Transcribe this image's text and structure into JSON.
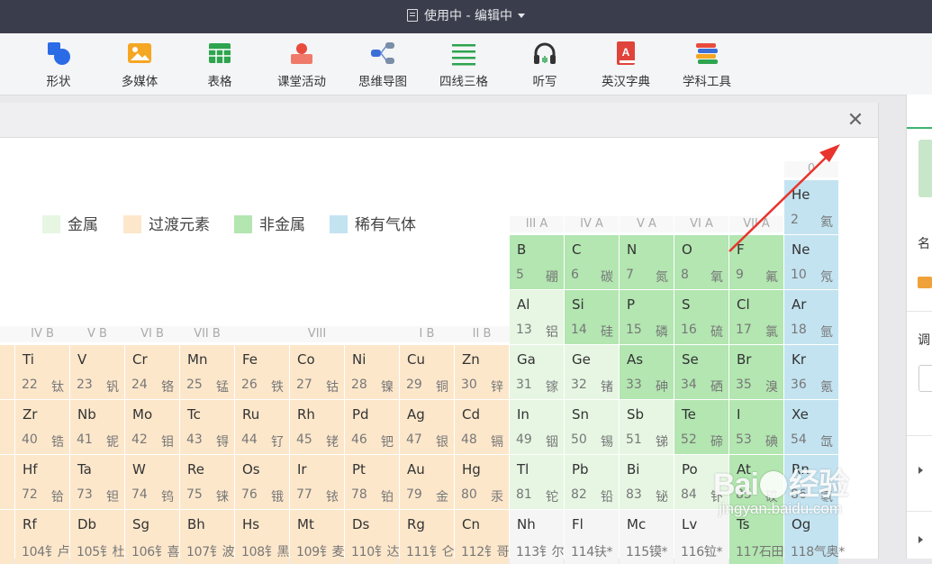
{
  "window": {
    "title": "使用中 - 编辑中"
  },
  "toolbar": [
    {
      "label": "形状",
      "icon": "shapes-icon"
    },
    {
      "label": "多媒体",
      "icon": "image-icon"
    },
    {
      "label": "表格",
      "icon": "table-icon"
    },
    {
      "label": "课堂活动",
      "icon": "classroom-activity-icon"
    },
    {
      "label": "思维导图",
      "icon": "mind-map-icon"
    },
    {
      "label": "四线三格",
      "icon": "four-line-grid-icon"
    },
    {
      "label": "听写",
      "icon": "headphones-icon"
    },
    {
      "label": "英汉字典",
      "icon": "dictionary-icon"
    },
    {
      "label": "学科工具",
      "icon": "books-icon"
    }
  ],
  "right_panel": {
    "name_label": "名",
    "adjust_label": "调"
  },
  "dialog": {
    "close_icon": "✕"
  },
  "legend": [
    {
      "label": "金属",
      "color": "#e6f6e3"
    },
    {
      "label": "过渡元素",
      "color": "#fde7cb"
    },
    {
      "label": "非金属",
      "color": "#b3e6b1"
    },
    {
      "label": "稀有气体",
      "color": "#c3e3f1"
    }
  ],
  "colors": {
    "metal": "#e6f6e3",
    "transition": "#fde7cb",
    "nonmetal": "#b3e6b1",
    "noble": "#c3e3f1",
    "other": "#f5f5f5"
  },
  "groups": [
    "IV B",
    "V B",
    "VI B",
    "VII B",
    "VIII",
    "I B",
    "II B",
    "III A",
    "IV A",
    "V A",
    "VI A",
    "VII A",
    "0"
  ],
  "elements": [
    {
      "s": "He",
      "n": "2",
      "c": "氦",
      "t": "noble"
    },
    {
      "s": "B",
      "n": "5",
      "c": "硼",
      "t": "nonmetal"
    },
    {
      "s": "C",
      "n": "6",
      "c": "碳",
      "t": "nonmetal"
    },
    {
      "s": "N",
      "n": "7",
      "c": "氮",
      "t": "nonmetal"
    },
    {
      "s": "O",
      "n": "8",
      "c": "氧",
      "t": "nonmetal"
    },
    {
      "s": "F",
      "n": "9",
      "c": "氟",
      "t": "nonmetal"
    },
    {
      "s": "Ne",
      "n": "10",
      "c": "氖",
      "t": "noble"
    },
    {
      "s": "Al",
      "n": "13",
      "c": "铝",
      "t": "metal"
    },
    {
      "s": "Si",
      "n": "14",
      "c": "硅",
      "t": "nonmetal"
    },
    {
      "s": "P",
      "n": "15",
      "c": "磷",
      "t": "nonmetal"
    },
    {
      "s": "S",
      "n": "16",
      "c": "硫",
      "t": "nonmetal"
    },
    {
      "s": "Cl",
      "n": "17",
      "c": "氯",
      "t": "nonmetal"
    },
    {
      "s": "Ar",
      "n": "18",
      "c": "氩",
      "t": "noble"
    },
    {
      "s": "Ti",
      "n": "22",
      "c": "钛",
      "t": "transition"
    },
    {
      "s": "V",
      "n": "23",
      "c": "钒",
      "t": "transition"
    },
    {
      "s": "Cr",
      "n": "24",
      "c": "铬",
      "t": "transition"
    },
    {
      "s": "Mn",
      "n": "25",
      "c": "锰",
      "t": "transition"
    },
    {
      "s": "Fe",
      "n": "26",
      "c": "铁",
      "t": "transition"
    },
    {
      "s": "Co",
      "n": "27",
      "c": "钴",
      "t": "transition"
    },
    {
      "s": "Ni",
      "n": "28",
      "c": "镍",
      "t": "transition"
    },
    {
      "s": "Cu",
      "n": "29",
      "c": "铜",
      "t": "transition"
    },
    {
      "s": "Zn",
      "n": "30",
      "c": "锌",
      "t": "transition"
    },
    {
      "s": "Ga",
      "n": "31",
      "c": "镓",
      "t": "metal"
    },
    {
      "s": "Ge",
      "n": "32",
      "c": "锗",
      "t": "metal"
    },
    {
      "s": "As",
      "n": "33",
      "c": "砷",
      "t": "nonmetal"
    },
    {
      "s": "Se",
      "n": "34",
      "c": "硒",
      "t": "nonmetal"
    },
    {
      "s": "Br",
      "n": "35",
      "c": "溴",
      "t": "nonmetal"
    },
    {
      "s": "Kr",
      "n": "36",
      "c": "氪",
      "t": "noble"
    },
    {
      "s": "Zr",
      "n": "40",
      "c": "锆",
      "t": "transition"
    },
    {
      "s": "Nb",
      "n": "41",
      "c": "铌",
      "t": "transition"
    },
    {
      "s": "Mo",
      "n": "42",
      "c": "钼",
      "t": "transition"
    },
    {
      "s": "Tc",
      "n": "43",
      "c": "锝",
      "t": "transition"
    },
    {
      "s": "Ru",
      "n": "44",
      "c": "钌",
      "t": "transition"
    },
    {
      "s": "Rh",
      "n": "45",
      "c": "铑",
      "t": "transition"
    },
    {
      "s": "Pd",
      "n": "46",
      "c": "钯",
      "t": "transition"
    },
    {
      "s": "Ag",
      "n": "47",
      "c": "银",
      "t": "transition"
    },
    {
      "s": "Cd",
      "n": "48",
      "c": "镉",
      "t": "transition"
    },
    {
      "s": "In",
      "n": "49",
      "c": "铟",
      "t": "metal"
    },
    {
      "s": "Sn",
      "n": "50",
      "c": "锡",
      "t": "metal"
    },
    {
      "s": "Sb",
      "n": "51",
      "c": "锑",
      "t": "metal"
    },
    {
      "s": "Te",
      "n": "52",
      "c": "碲",
      "t": "nonmetal"
    },
    {
      "s": "I",
      "n": "53",
      "c": "碘",
      "t": "nonmetal"
    },
    {
      "s": "Xe",
      "n": "54",
      "c": "氙",
      "t": "noble"
    },
    {
      "s": "Hf",
      "n": "72",
      "c": "铪",
      "t": "transition"
    },
    {
      "s": "Ta",
      "n": "73",
      "c": "钽",
      "t": "transition"
    },
    {
      "s": "W",
      "n": "74",
      "c": "钨",
      "t": "transition"
    },
    {
      "s": "Re",
      "n": "75",
      "c": "铼",
      "t": "transition"
    },
    {
      "s": "Os",
      "n": "76",
      "c": "锇",
      "t": "transition"
    },
    {
      "s": "Ir",
      "n": "77",
      "c": "铱",
      "t": "transition"
    },
    {
      "s": "Pt",
      "n": "78",
      "c": "铂",
      "t": "transition"
    },
    {
      "s": "Au",
      "n": "79",
      "c": "金",
      "t": "transition"
    },
    {
      "s": "Hg",
      "n": "80",
      "c": "汞",
      "t": "transition"
    },
    {
      "s": "Tl",
      "n": "81",
      "c": "铊",
      "t": "metal"
    },
    {
      "s": "Pb",
      "n": "82",
      "c": "铅",
      "t": "metal"
    },
    {
      "s": "Bi",
      "n": "83",
      "c": "铋",
      "t": "metal"
    },
    {
      "s": "Po",
      "n": "84",
      "c": "钋",
      "t": "metal"
    },
    {
      "s": "At",
      "n": "85",
      "c": "砹",
      "t": "nonmetal"
    },
    {
      "s": "Rn",
      "n": "86",
      "c": "氡",
      "t": "noble"
    },
    {
      "s": "Rf",
      "n": "104",
      "c": "钅卢*",
      "t": "transition",
      "comb": true
    },
    {
      "s": "Db",
      "n": "105",
      "c": "钅杜*",
      "t": "transition",
      "comb": true
    },
    {
      "s": "Sg",
      "n": "106",
      "c": "钅喜*",
      "t": "transition",
      "comb": true
    },
    {
      "s": "Bh",
      "n": "107",
      "c": "钅波*",
      "t": "transition",
      "comb": true
    },
    {
      "s": "Hs",
      "n": "108",
      "c": "钅黑*",
      "t": "transition",
      "comb": true
    },
    {
      "s": "Mt",
      "n": "109",
      "c": "钅麦*",
      "t": "transition",
      "comb": true
    },
    {
      "s": "Ds",
      "n": "110",
      "c": "钅达*",
      "t": "transition",
      "comb": true
    },
    {
      "s": "Rg",
      "n": "111",
      "c": "钅仑*",
      "t": "transition",
      "comb": true
    },
    {
      "s": "Cn",
      "n": "112",
      "c": "钅哥*",
      "t": "transition",
      "comb": true
    },
    {
      "s": "Nh",
      "n": "113",
      "c": "钅尔*",
      "t": "other",
      "comb": true
    },
    {
      "s": "Fl",
      "n": "114",
      "c": "𫓧*",
      "t": "other",
      "comb": true
    },
    {
      "s": "Mc",
      "n": "115",
      "c": "镆*",
      "t": "other",
      "comb": true
    },
    {
      "s": "Lv",
      "n": "116",
      "c": "𫟷*",
      "t": "other",
      "comb": true
    },
    {
      "s": "Ts",
      "n": "117",
      "c": "石田*",
      "t": "nonmetal",
      "comb": true
    },
    {
      "s": "Og",
      "n": "118",
      "c": "气奥*",
      "t": "noble",
      "comb": true
    }
  ],
  "watermark": {
    "brand": "Bai 经验",
    "site": "jingyan.baidu.com"
  }
}
